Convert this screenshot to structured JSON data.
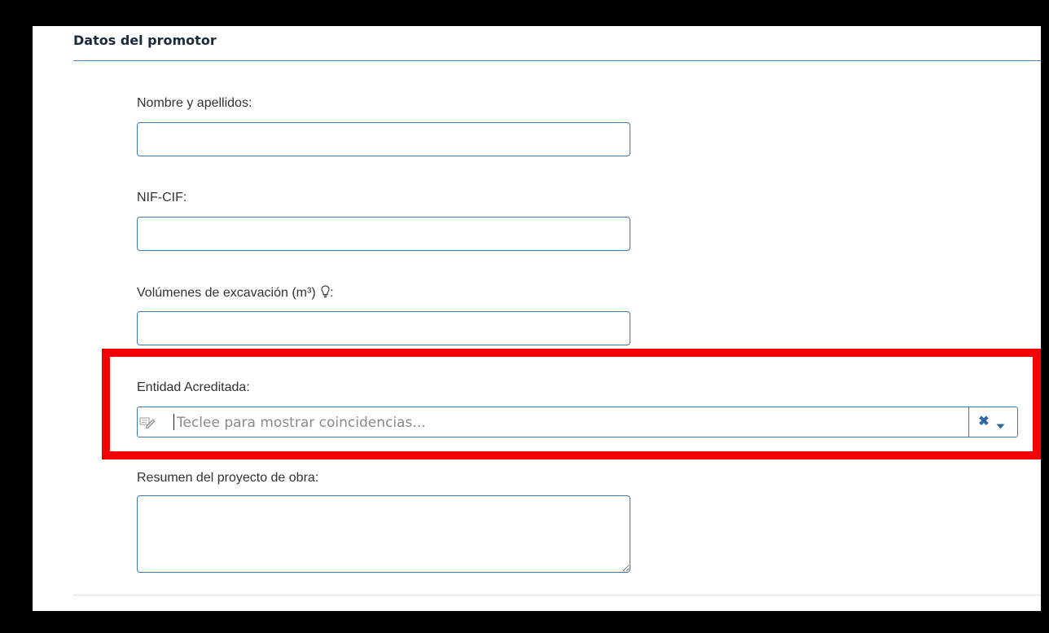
{
  "section": {
    "title": "Datos del promotor"
  },
  "fields": {
    "nombre": {
      "label": "Nombre y apellidos:",
      "value": ""
    },
    "nif": {
      "label": "NIF-CIF:",
      "value": ""
    },
    "volumenes": {
      "label_prefix": "Volúmenes de excavación (m³)",
      "label_suffix": ":",
      "value": ""
    },
    "entidad": {
      "label": "Entidad Acreditada:",
      "placeholder": "Teclee para mostrar coincidencias...",
      "clear_glyph": "✖"
    },
    "resumen": {
      "label": "Resumen del proyecto de obra:",
      "value": ""
    }
  },
  "colors": {
    "border": "#3c79a8",
    "highlight": "#f30000",
    "accent": "#2b6aa5"
  },
  "icons": [
    "lightbulb-icon",
    "pencil-icon",
    "clear-icon",
    "chevron-down-icon"
  ]
}
